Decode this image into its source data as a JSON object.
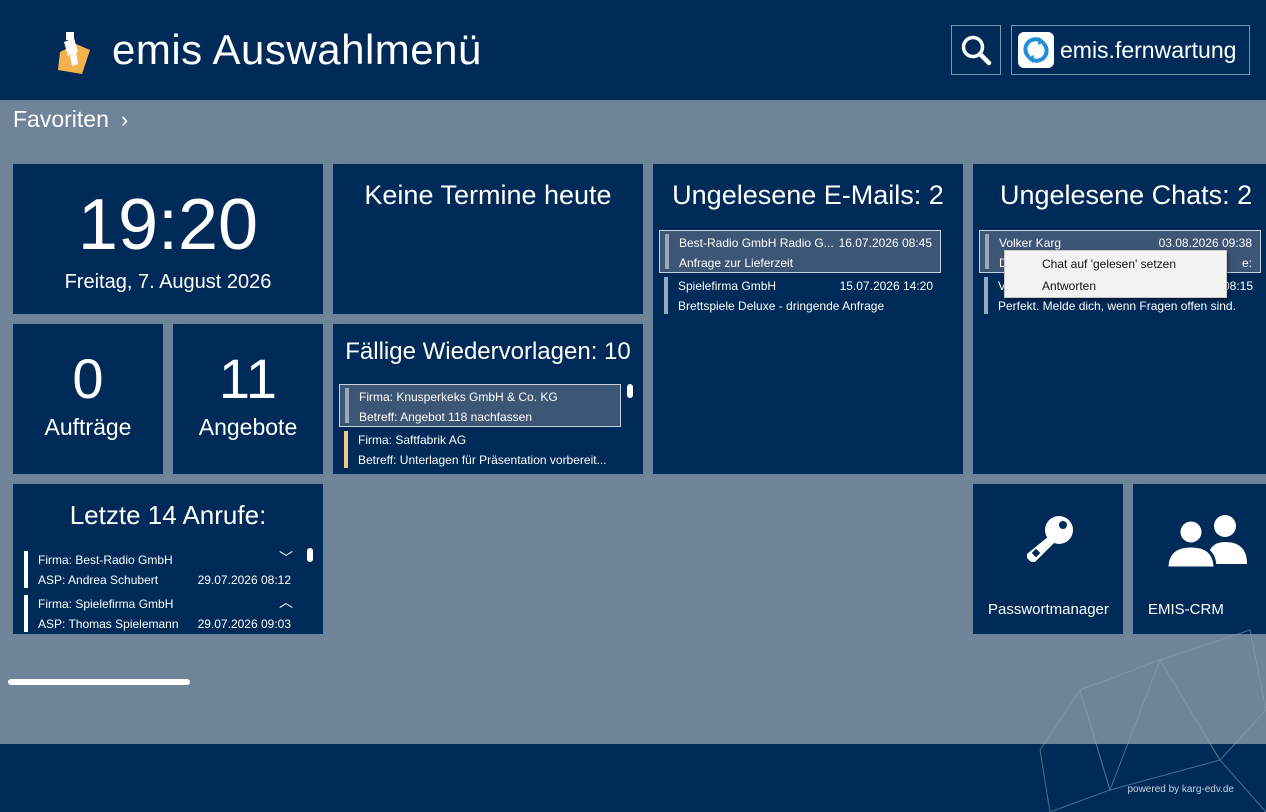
{
  "header": {
    "title": "emis Auswahlmenü",
    "remote_label": "emis.fernwartung"
  },
  "favorites": {
    "label": "Favoriten",
    "chevron": "›"
  },
  "clock": {
    "time": "19:20",
    "date": "Freitag, 7. August 2026"
  },
  "termine": {
    "title": "Keine Termine heute"
  },
  "emails": {
    "title": "Ungelesene E-Mails: 2",
    "items": [
      {
        "from": "Best-Radio GmbH Radio G...",
        "date": "16.07.2026 08:45",
        "subject": "Anfrage zur Lieferzeit"
      },
      {
        "from": "Spielefirma GmbH",
        "date": "15.07.2026 14:20",
        "subject": "Brettspiele Deluxe - dringende Anfrage"
      }
    ]
  },
  "chats": {
    "title": "Ungelesene Chats: 2",
    "items": [
      {
        "from": "Volker Karg",
        "date": "03.08.2026 09:38",
        "prefix": "D",
        "tail": "e:"
      },
      {
        "from": "V",
        "date": "08:15",
        "message": "Perfekt. Melde dich, wenn Fragen offen sind."
      }
    ]
  },
  "context_menu": {
    "items": [
      "Chat auf 'gelesen' setzen",
      "Antworten"
    ]
  },
  "auftraege": {
    "count": "0",
    "label": "Aufträge"
  },
  "angebote": {
    "count": "11",
    "label": "Angebote"
  },
  "wiedervorlagen": {
    "title": "Fällige Wiedervorlagen: 10",
    "items": [
      {
        "line1": "Firma: Knusperkeks GmbH & Co. KG",
        "line2": "Betreff: Angebot 118 nachfassen"
      },
      {
        "line1": "Firma: Saftfabrik AG",
        "line2": "Betreff: Unterlagen für Präsentation vorbereit..."
      }
    ]
  },
  "anrufe": {
    "title": "Letzte 14 Anrufe:",
    "items": [
      {
        "line1": "Firma: Best-Radio GmbH",
        "line2": "ASP: Andrea Schubert",
        "date": "29.07.2026 08:12",
        "toggle": "﹀"
      },
      {
        "line1": "Firma: Spielefirma GmbH",
        "line2": "ASP: Thomas Spielemann",
        "date": "29.07.2026 09:03",
        "toggle": "︿"
      }
    ]
  },
  "apps": [
    {
      "label": "Passwortmanager",
      "icon": "key-icon"
    },
    {
      "label": "EMIS-CRM",
      "icon": "users-icon"
    }
  ],
  "footer": {
    "powered": "powered by karg-edv.de"
  },
  "colors": {
    "primary": "#002a57",
    "background": "#6f8399",
    "selected": "#3d5675",
    "accent_orange": "#f2c77f"
  }
}
